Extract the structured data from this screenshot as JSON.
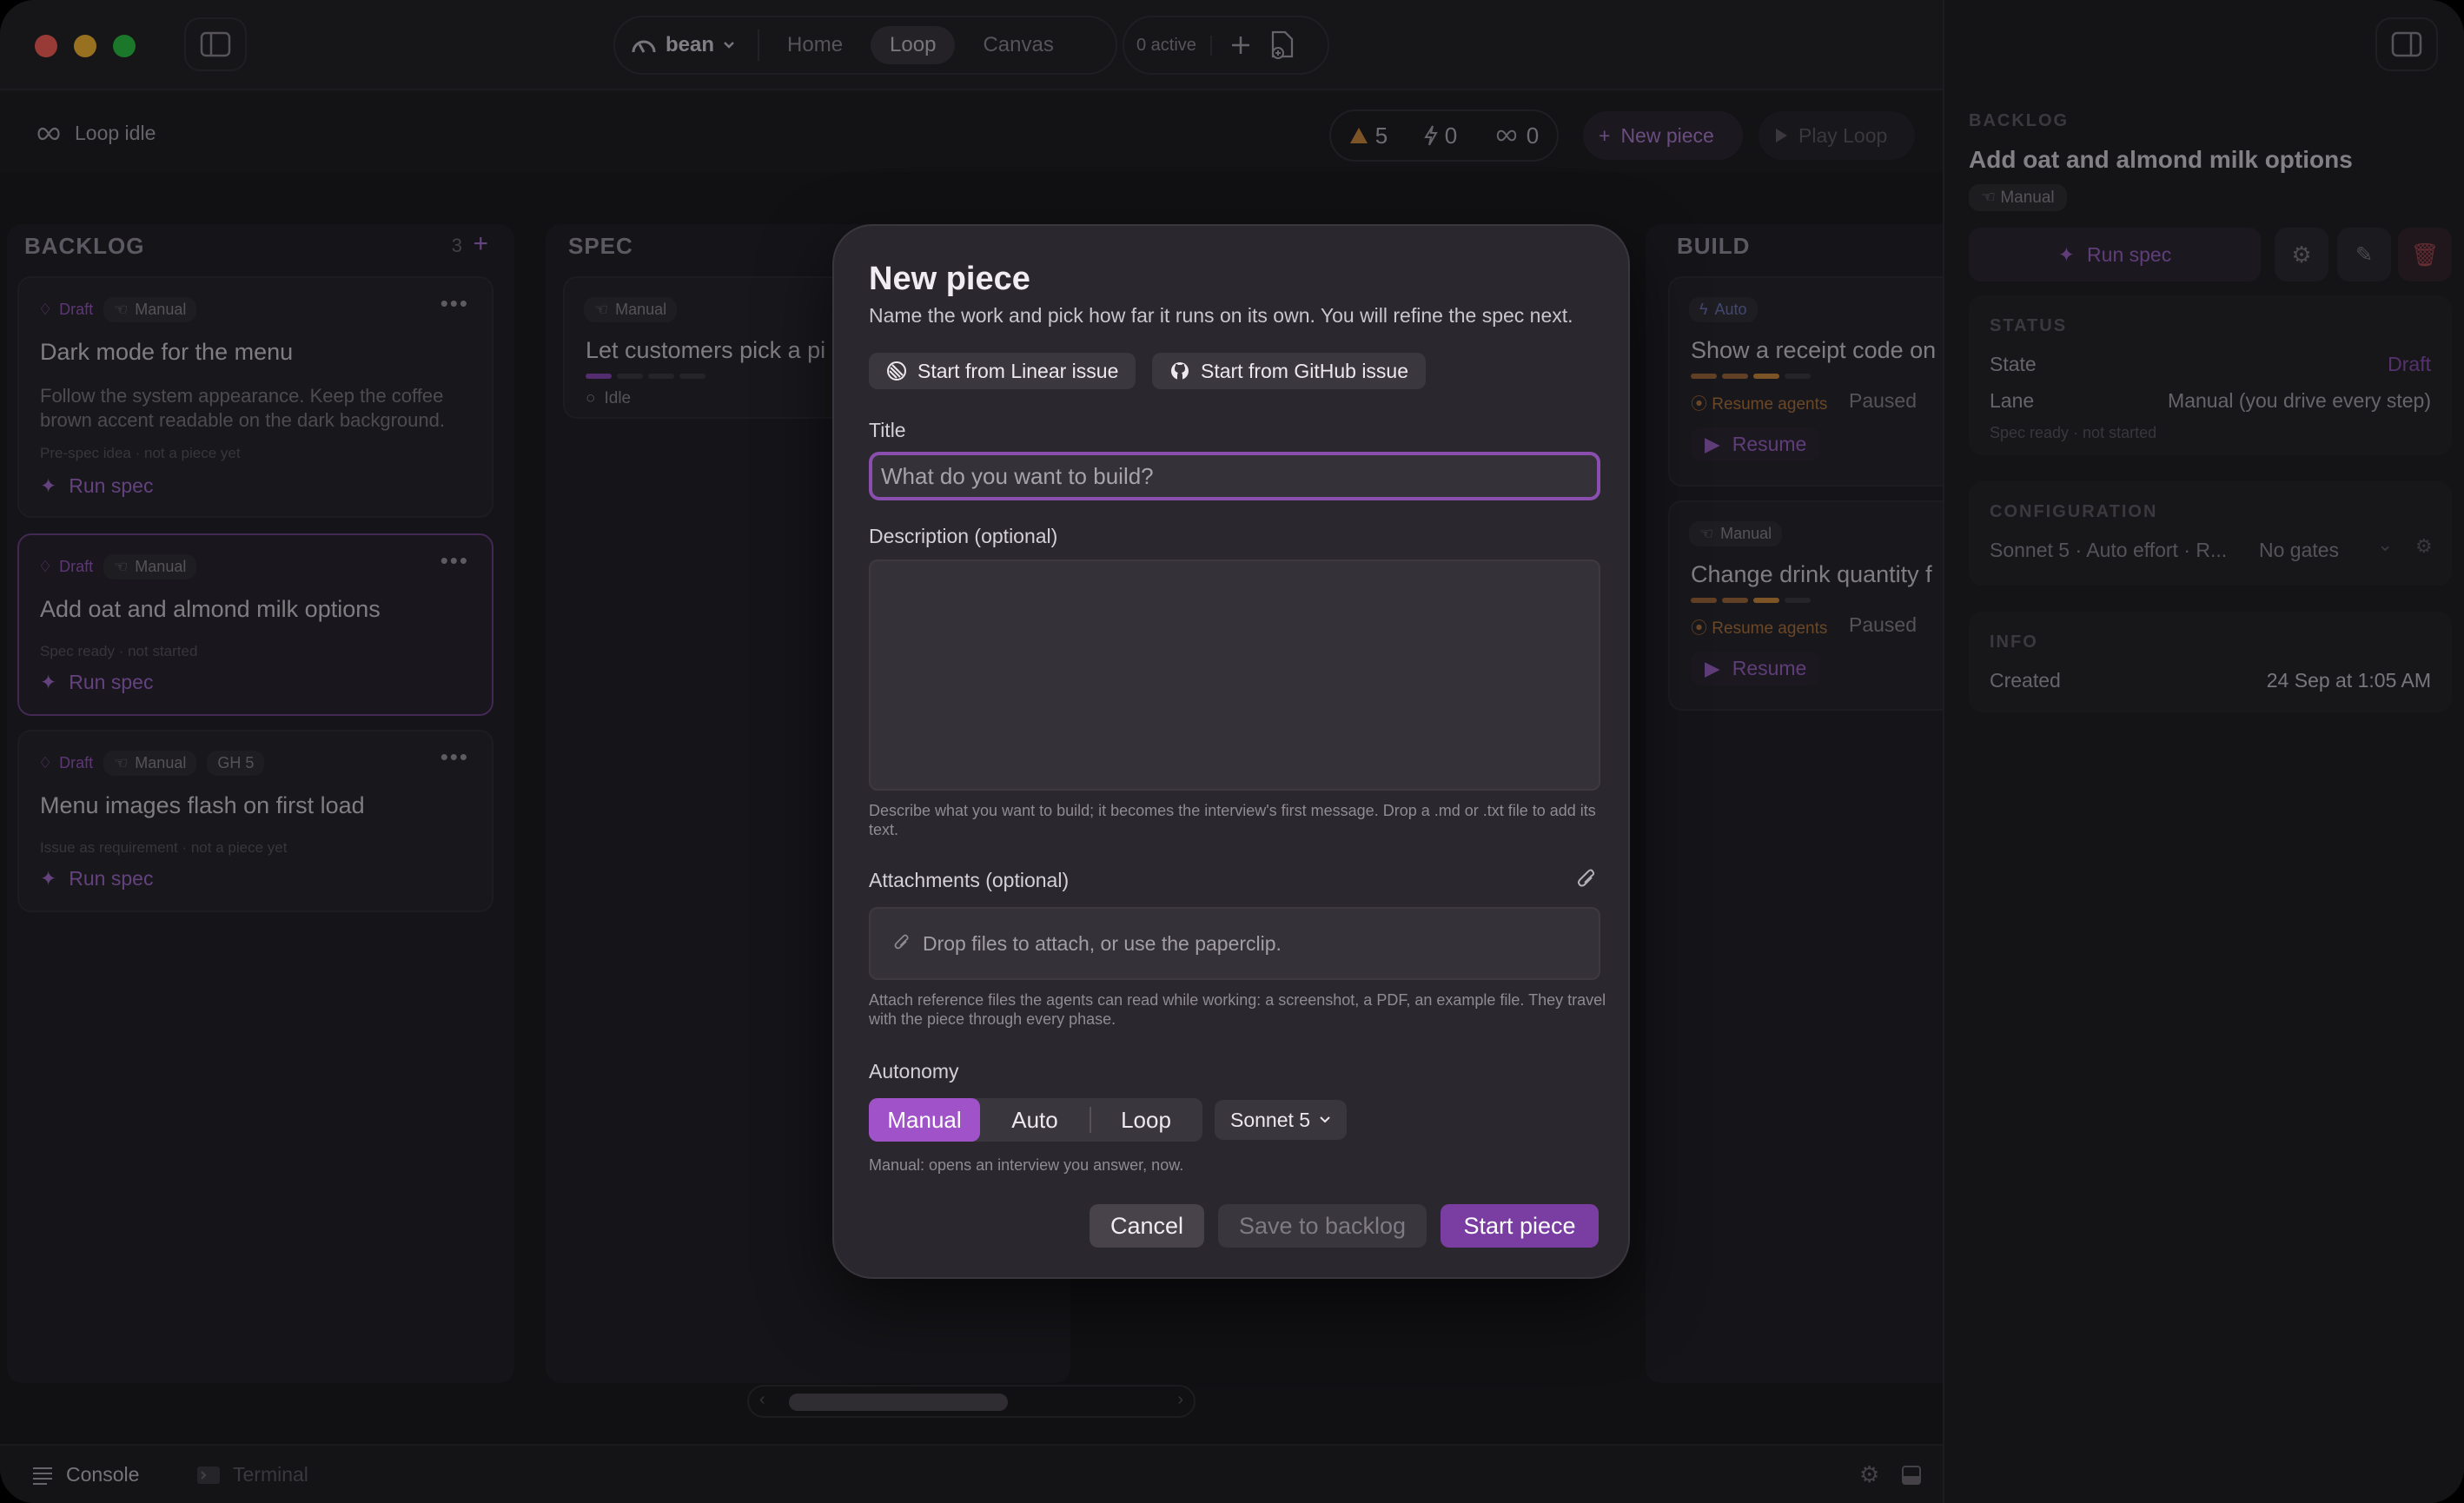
{
  "titlebar": {
    "workspace": "bean",
    "tabs": [
      "Home",
      "Loop",
      "Canvas"
    ],
    "active_tab": "Loop",
    "active_count": "0 active"
  },
  "subbar": {
    "loop_status": "Loop idle",
    "stats": {
      "warnings": "5",
      "bolts": "0",
      "loops": "0"
    },
    "new_piece": "New piece",
    "play_loop": "Play Loop"
  },
  "columns": {
    "backlog": {
      "title": "BACKLOG",
      "count": "3",
      "cards": [
        {
          "status": "Draft",
          "lane": "Manual",
          "title": "Dark mode for the menu",
          "desc": "Follow the system appearance. Keep the coffee brown accent readable on the dark background.",
          "meta": "Pre-spec idea · not a piece yet",
          "action": "Run spec"
        },
        {
          "status": "Draft",
          "lane": "Manual",
          "title": "Add oat and almond milk options",
          "meta": "Spec ready · not started",
          "action": "Run spec"
        },
        {
          "status": "Draft",
          "lane": "Manual",
          "issue": "GH 5",
          "title": "Menu images flash on first load",
          "meta": "Issue as requirement · not a piece yet",
          "action": "Run spec"
        }
      ]
    },
    "spec": {
      "title": "SPEC",
      "cards": [
        {
          "lane": "Manual",
          "title": "Let customers pick a pi",
          "state": "Idle"
        }
      ]
    },
    "build": {
      "title": "BUILD",
      "cards": [
        {
          "lane": "Auto",
          "title": "Show a receipt code on",
          "agents": "Resume agents",
          "state": "Paused",
          "action": "Resume"
        },
        {
          "lane": "Manual",
          "title": "Change drink quantity f",
          "agents": "Resume agents",
          "state": "Paused",
          "action": "Resume"
        }
      ]
    }
  },
  "right_panel": {
    "section": "BACKLOG",
    "title": "Add oat and almond milk options",
    "lane_badge": "Manual",
    "run_spec": "Run spec",
    "status_label": "STATUS",
    "state_key": "State",
    "state_value": "Draft",
    "lane_key": "Lane",
    "lane_value": "Manual (you drive every step)",
    "status_note": "Spec ready · not started",
    "config_label": "CONFIGURATION",
    "config_value": "Sonnet 5 · Auto effort · R...",
    "gates": "No gates",
    "info_label": "INFO",
    "created_key": "Created",
    "created_value": "24 Sep at 1:05 AM"
  },
  "bottombar": {
    "console": "Console",
    "terminal": "Terminal"
  },
  "modal": {
    "title": "New piece",
    "subtitle": "Name the work and pick how far it runs on its own. You will refine the spec next.",
    "linear_btn": "Start from Linear issue",
    "github_btn": "Start from GitHub issue",
    "title_label": "Title",
    "title_placeholder": "What do you want to build?",
    "desc_label": "Description (optional)",
    "desc_help": "Describe what you want to build; it becomes the interview's first message. Drop a .md or .txt file to add its text.",
    "attach_label": "Attachments (optional)",
    "attach_drop": "Drop files to attach, or use the paperclip.",
    "attach_help": "Attach reference files the agents can read while working: a screenshot, a PDF, an example file. They travel with the piece through every phase.",
    "autonomy_label": "Autonomy",
    "autonomy_options": [
      "Manual",
      "Auto",
      "Loop"
    ],
    "autonomy_selected": "Manual",
    "model": "Sonnet 5",
    "autonomy_help": "Manual: opens an interview you answer, now.",
    "cancel": "Cancel",
    "save": "Save to backlog",
    "start": "Start piece"
  }
}
